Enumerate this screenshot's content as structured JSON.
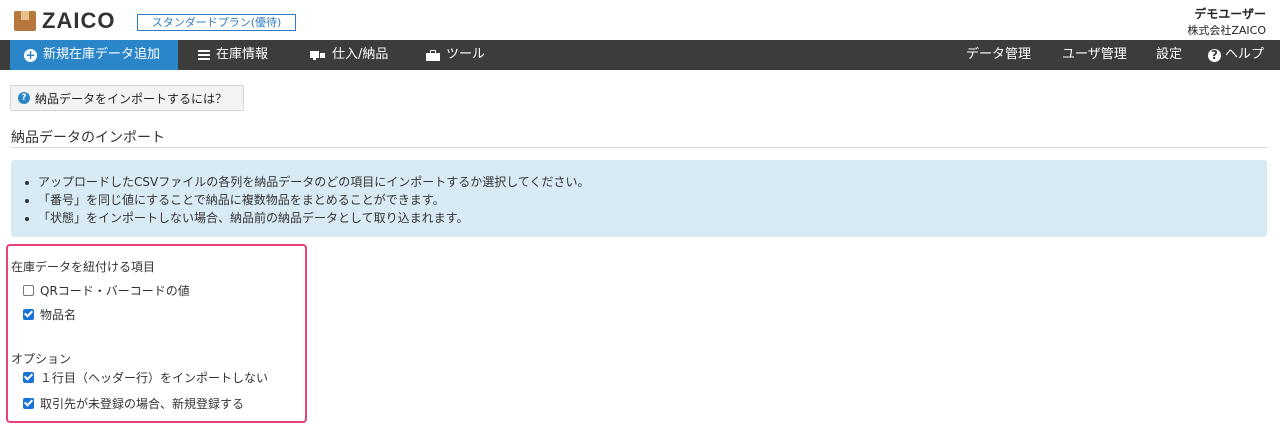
{
  "header": {
    "logo_text": "ZAICO",
    "plan_badge": "スタンダードプラン(優待)",
    "user_name": "デモユーザー",
    "company_name": "株式会社ZAICO"
  },
  "nav": {
    "left": [
      {
        "label": "新規在庫データ追加",
        "icon": "plus-circle-icon",
        "active": true
      },
      {
        "label": "在庫情報",
        "icon": "list-icon"
      },
      {
        "label": "仕入/納品",
        "icon": "truck-icon"
      },
      {
        "label": "ツール",
        "icon": "toolbox-icon"
      }
    ],
    "right": [
      {
        "label": "データ管理"
      },
      {
        "label": "ユーザ管理"
      },
      {
        "label": "設定"
      },
      {
        "label": "ヘルプ",
        "icon": "question-circle-icon"
      }
    ]
  },
  "help_button": {
    "label": "納品データをインポートするには？",
    "icon": "question-circle-icon"
  },
  "section_title": "納品データのインポート",
  "info_bullets": [
    "アップロードしたCSVファイルの各列を納品データのどの項目にインポートするか選択してください。",
    "「番号」を同じ値にすることで納品に複数物品をまとめることができます。",
    "「状態」をインポートしない場合、納品前の納品データとして取り込まれます。"
  ],
  "link_items": {
    "label": "在庫データを紐付ける項目",
    "options": [
      {
        "label": "QRコード・バーコードの値",
        "checked": false
      },
      {
        "label": "物品名",
        "checked": true
      }
    ]
  },
  "options": {
    "label": "オプション",
    "options": [
      {
        "label": "１行目（ヘッダー行）をインポートしない",
        "checked": true
      },
      {
        "label": "取引先が未登録の場合、新規登録する",
        "checked": true
      }
    ]
  },
  "colors": {
    "accent": "#2b86c9",
    "navbar": "#3c3c3c",
    "highlight": "#e6417a",
    "info_bg": "#d8eaf4"
  }
}
